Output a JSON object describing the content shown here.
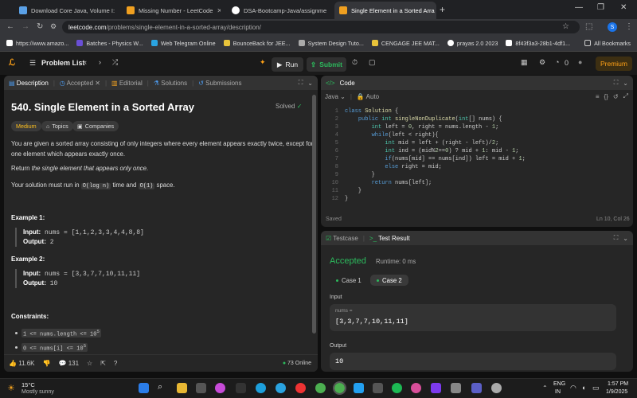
{
  "browser": {
    "tabs": [
      {
        "title": "Download Core Java, Volume I:",
        "color": "#5aa0e6",
        "glyph": "D"
      },
      {
        "title": "Missing Number - LeetCode",
        "color": "#f0a020",
        "glyph": "L"
      },
      {
        "title": "DSA-Bootcamp-Java/assignme",
        "color": "#ffffff",
        "glyph": "G"
      },
      {
        "title": "Single Element in a Sorted Arra",
        "color": "#f0a020",
        "glyph": "L"
      }
    ],
    "url_host": "leetcode.com",
    "url_path": "/problems/single-element-in-a-sorted-array/description/",
    "bookmarks": [
      {
        "label": "https://www.amazo...",
        "color": "#ffffff"
      },
      {
        "label": "Batches - Physics W...",
        "color": "#6a4fd6"
      },
      {
        "label": "Web Telegram Online",
        "color": "#2aa3e0"
      },
      {
        "label": "BounceBack for JEE...",
        "color": "#e8c33a"
      },
      {
        "label": "System Design Tuto...",
        "color": "#aaaaaa"
      },
      {
        "label": "CENGAGE JEE MAT...",
        "color": "#e8c33a"
      },
      {
        "label": "prayas 2.0 2023",
        "color": "#ffffff"
      },
      {
        "label": "8f43f3a3-28b1-4df1...",
        "color": "#ffffff"
      }
    ],
    "all_bookmarks": "All Bookmarks",
    "profile": "S"
  },
  "nav": {
    "problem_list": "Problem List",
    "run": "Run",
    "submit": "Submit",
    "streak": "0",
    "premium": "Premium"
  },
  "desc": {
    "tabs": [
      "Description",
      "Accepted",
      "Editorial",
      "Solutions",
      "Submissions"
    ],
    "title": "540. Single Element in a Sorted Array",
    "solved": "Solved",
    "difficulty": "Medium",
    "topics": "Topics",
    "companies": "Companies",
    "p1": "You are given a sorted array consisting of only integers where every element appears exactly twice, except for one element which appears exactly once.",
    "p2_pre": "Return ",
    "p2_em": "the single element that appears only once",
    "p2_post": ".",
    "p3_pre": "Your solution must run in ",
    "p3_c1": "O(log n)",
    "p3_mid": " time and ",
    "p3_c2": "O(1)",
    "p3_post": " space.",
    "ex1_title": "Example 1:",
    "ex1_input_label": "Input:",
    "ex1_input": "nums = [1,1,2,3,3,4,4,8,8]",
    "ex1_output_label": "Output:",
    "ex1_output": "2",
    "ex2_title": "Example 2:",
    "ex2_input_label": "Input:",
    "ex2_input": "nums = [3,3,7,7,10,11,11]",
    "ex2_output_label": "Output:",
    "ex2_output": "10",
    "constraints_title": "Constraints:",
    "c1": "1 <= nums.length <= 10",
    "c1_sup": "5",
    "c2": "0 <= nums[i] <= 10",
    "c2_sup": "5",
    "likes": "11.6K",
    "comments": "131",
    "online": "73 Online"
  },
  "code": {
    "title": "Code",
    "language": "Java",
    "mode": "Auto",
    "lines": [
      "class Solution {",
      "    public int singleNonDuplicate(int[] nums) {",
      "        int left = 0, right = nums.length - 1;",
      "        while(left < right){",
      "            int mid = left + (right - left)/2;",
      "            int ind = (mid%2==0) ? mid + 1: mid - 1;",
      "            if(nums[mid] == nums[ind]) left = mid + 1;",
      "            else right = mid;",
      "        }",
      "        return nums[left];",
      "    }",
      "}"
    ],
    "line_numbers": [
      "1",
      "2",
      "3",
      "4",
      "5",
      "6",
      "7",
      "8",
      "9",
      "10",
      "11",
      "12"
    ],
    "status": "Saved",
    "cursor": "Ln 10, Col 26"
  },
  "result": {
    "tabs": [
      "Testcase",
      "Test Result"
    ],
    "verdict": "Accepted",
    "runtime": "Runtime: 0 ms",
    "cases": [
      "Case 1",
      "Case 2"
    ],
    "input_label": "Input",
    "var_name": "nums =",
    "var_value": "[3,3,7,7,10,11,11]",
    "output_label": "Output",
    "output_value": "10"
  },
  "taskbar": {
    "temp": "15°C",
    "weather": "Mostly sunny",
    "lang1": "ENG",
    "lang2": "IN",
    "time": "1:57 PM",
    "date": "1/9/2025"
  }
}
